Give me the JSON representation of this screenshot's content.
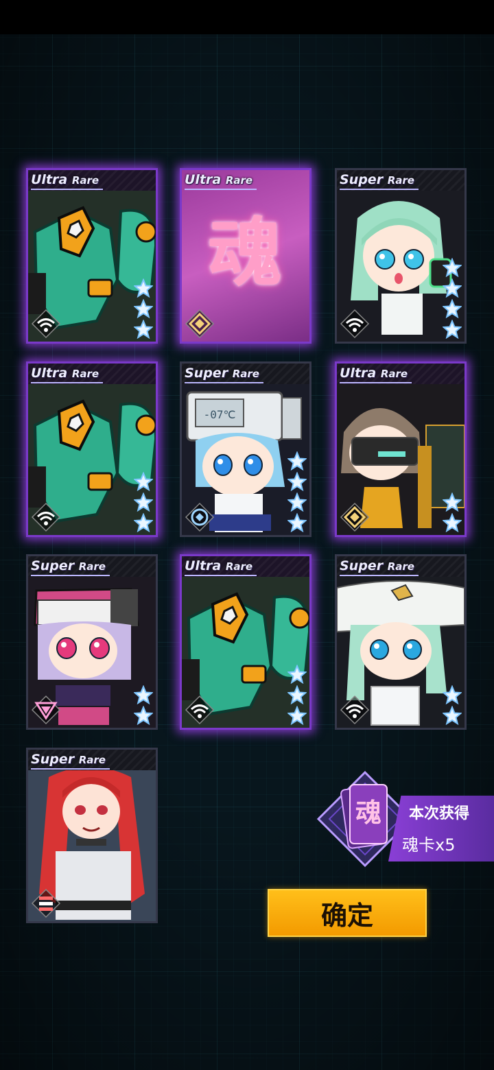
{
  "cards": [
    {
      "rarity_word": "Ultra",
      "rarity_suffix": "Rare",
      "tier": "ur",
      "art": "green-mech",
      "stars": 3,
      "class_icon": "wifi-icon"
    },
    {
      "rarity_word": "Ultra",
      "rarity_suffix": "Rare",
      "tier": "ur",
      "art": "soul-card",
      "soul_char": "魂",
      "stars": 0,
      "class_icon": "diamond-icon"
    },
    {
      "rarity_word": "Super",
      "rarity_suffix": "Rare",
      "tier": "sr",
      "art": "mint-hair-girl",
      "stars": 4,
      "class_icon": "wifi-icon"
    },
    {
      "rarity_word": "Ultra",
      "rarity_suffix": "Rare",
      "tier": "ur",
      "art": "green-mech",
      "stars": 3,
      "class_icon": "wifi-icon"
    },
    {
      "rarity_word": "Super",
      "rarity_suffix": "Rare",
      "tier": "sr",
      "art": "fridge-head-girl",
      "screen_text": "-07℃",
      "stars": 4,
      "class_icon": "target-icon"
    },
    {
      "rarity_word": "Ultra",
      "rarity_suffix": "Rare",
      "tier": "ur",
      "art": "visor-girl",
      "stars": 2,
      "class_icon": "diamond-icon"
    },
    {
      "rarity_word": "Super",
      "rarity_suffix": "Rare",
      "tier": "sr",
      "art": "pink-eye-girl",
      "stars": 2,
      "class_icon": "triangle-icon"
    },
    {
      "rarity_word": "Ultra",
      "rarity_suffix": "Rare",
      "tier": "ur",
      "art": "green-mech",
      "stars": 3,
      "class_icon": "wifi-icon"
    },
    {
      "rarity_word": "Super",
      "rarity_suffix": "Rare",
      "tier": "sr",
      "art": "white-hat-girl",
      "stars": 2,
      "class_icon": "wifi-icon"
    },
    {
      "rarity_word": "Super",
      "rarity_suffix": "Rare",
      "tier": "sr",
      "art": "red-hair-girl",
      "stars": 0,
      "class_icon": "flag-icon"
    }
  ],
  "reward": {
    "badge_char": "魂",
    "title": "本次获得",
    "detail": "魂卡x5"
  },
  "confirm_label": "确定",
  "colors": {
    "ur_glow": "#a046ff",
    "star": "#ffffff",
    "button": "#f7a600",
    "grid": "#286e78"
  }
}
